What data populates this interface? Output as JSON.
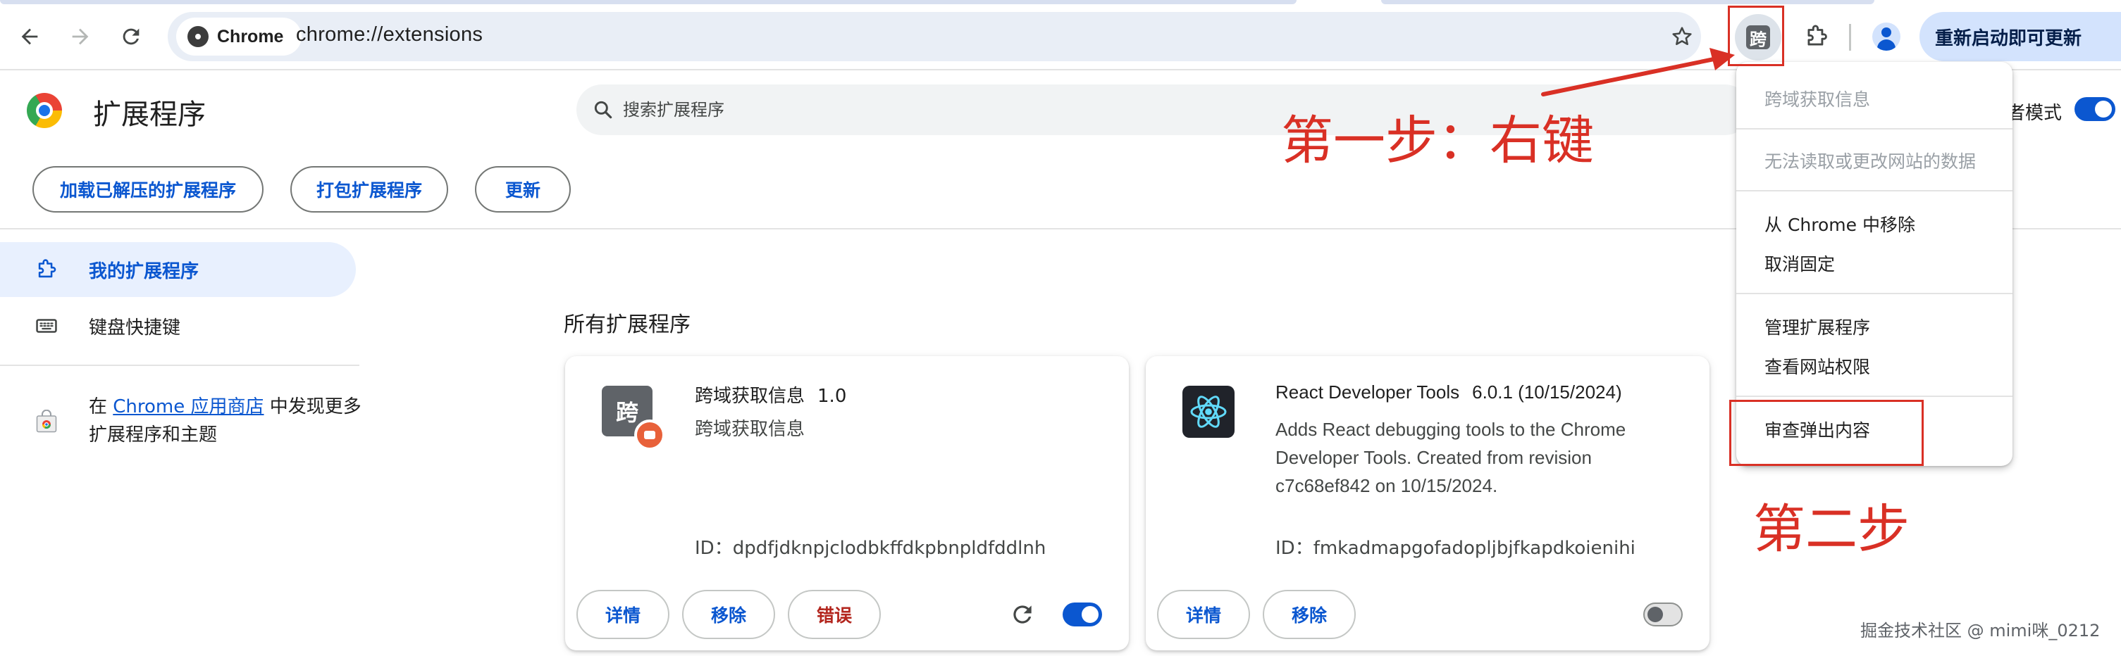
{
  "browser": {
    "site_chip": "Chrome",
    "url": "chrome://extensions",
    "update_button": "重新启动即可更新"
  },
  "header": {
    "title": "扩展程序",
    "search_placeholder": "搜索扩展程序",
    "dev_mode_label": "开发者模式",
    "dev_mode_on": true,
    "buttons": {
      "load_unpacked": "加载已解压的扩展程序",
      "pack": "打包扩展程序",
      "update": "更新"
    }
  },
  "sidebar": {
    "items": [
      {
        "label": "我的扩展程序",
        "icon": "extension-puzzle-icon",
        "active": true
      },
      {
        "label": "键盘快捷键",
        "icon": "keyboard-icon",
        "active": false
      }
    ],
    "store_promo": {
      "prefix": "在 ",
      "link": "Chrome 应用商店",
      "suffix": " 中发现更多扩展程序和主题"
    }
  },
  "main": {
    "section_title": "所有扩展程序",
    "extensions": [
      {
        "name": "跨域获取信息",
        "version": "1.0",
        "description": "跨域获取信息",
        "id_line": "ID：dpdfjdknpjclodbkffdkpbnpldfddlnh",
        "icon_text": "跨",
        "buttons": {
          "details": "详情",
          "remove": "移除",
          "errors": "错误"
        },
        "enabled": true
      },
      {
        "name": "React Developer Tools",
        "version": "6.0.1 (10/15/2024)",
        "description": "Adds React debugging tools to the Chrome Developer Tools. Created from revision c7c68ef842 on 10/15/2024.",
        "id_line": "ID：fmkadmapgofadopljbjfkapdkoienihi",
        "buttons": {
          "details": "详情",
          "remove": "移除"
        },
        "enabled": false
      }
    ]
  },
  "context_menu": {
    "items": [
      {
        "label": "跨域获取信息",
        "enabled": false
      },
      {
        "label": "无法读取或更改网站的数据",
        "enabled": false
      },
      {
        "label": "从 Chrome 中移除",
        "enabled": true
      },
      {
        "label": "取消固定",
        "enabled": true
      },
      {
        "label": "管理扩展程序",
        "enabled": true
      },
      {
        "label": "查看网站权限",
        "enabled": true
      },
      {
        "label": "审查弹出内容",
        "enabled": true
      }
    ]
  },
  "annotations": {
    "step1": "第一步：右键",
    "step2": "第二步",
    "color": "#d93025"
  },
  "watermark": "掘金技术社区 @ mimi咪_0212",
  "colors": {
    "accent": "#0b57d0",
    "error": "#b3261e",
    "annotation": "#d93025"
  }
}
